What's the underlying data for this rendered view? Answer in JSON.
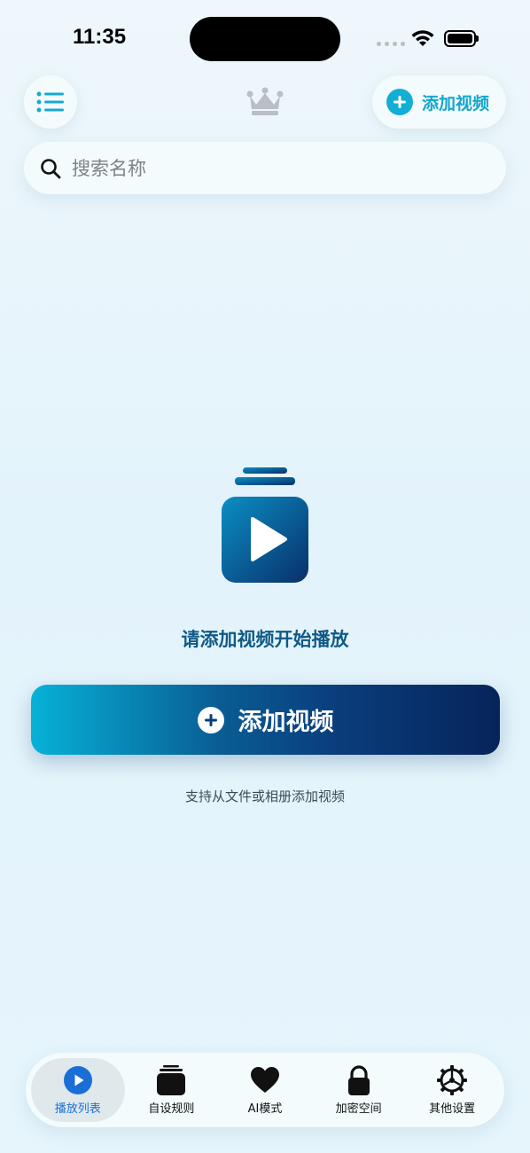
{
  "status": {
    "time": "11:35"
  },
  "top_bar": {
    "add_video_label": "添加视频"
  },
  "search": {
    "placeholder": "搜索名称",
    "value": ""
  },
  "empty_state": {
    "title": "请添加视频开始播放",
    "add_button_label": "添加视频",
    "hint": "支持从文件或相册添加视频"
  },
  "tabs": [
    {
      "label": "播放列表",
      "icon": "play-circle-icon",
      "active": true
    },
    {
      "label": "自设规则",
      "icon": "stack-icon",
      "active": false
    },
    {
      "label": "AI模式",
      "icon": "heart-icon",
      "active": false
    },
    {
      "label": "加密空间",
      "icon": "lock-icon",
      "active": false
    },
    {
      "label": "其他设置",
      "icon": "gear-icon",
      "active": false
    }
  ],
  "colors": {
    "accent": "#13aed6",
    "title_blue": "#0f5a86",
    "tab_active": "#1a6fd6",
    "gradient_start": "#06b2d8",
    "gradient_end": "#06245a"
  }
}
